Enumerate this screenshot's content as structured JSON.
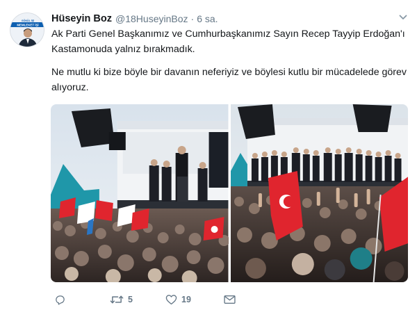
{
  "user": {
    "name": "Hüseyin Boz",
    "handle": "@18HuseyinBoz",
    "separator": "·",
    "time": "6 sa.",
    "avatar_banner": "MEMLEKET İŞİ GÖNÜL İŞİ"
  },
  "tweet": {
    "paragraphs": [
      "Ak Parti Genel Başkanımız ve Cumhurbaşkanımız Sayın Recep Tayyip Erdoğan'ı Kastamonuda yalnız bırakmadık.",
      "Ne mutlu ki bize böyle bir davanın neferiyiz ve böylesi kutlu bir mücadelede görev alıyoruz."
    ]
  },
  "media": {
    "photos": [
      {
        "label": "rally-photo-1"
      },
      {
        "label": "rally-photo-2"
      }
    ]
  },
  "actions": {
    "reply": {
      "icon": "reply-icon",
      "count": ""
    },
    "retweet": {
      "icon": "retweet-icon",
      "count": "5"
    },
    "like": {
      "icon": "heart-icon",
      "count": "19"
    },
    "message": {
      "icon": "envelope-icon"
    }
  },
  "colors": {
    "text": "#14171a",
    "muted": "#657786",
    "flag_red": "#e0252e",
    "sky": "#c9d6e2"
  }
}
